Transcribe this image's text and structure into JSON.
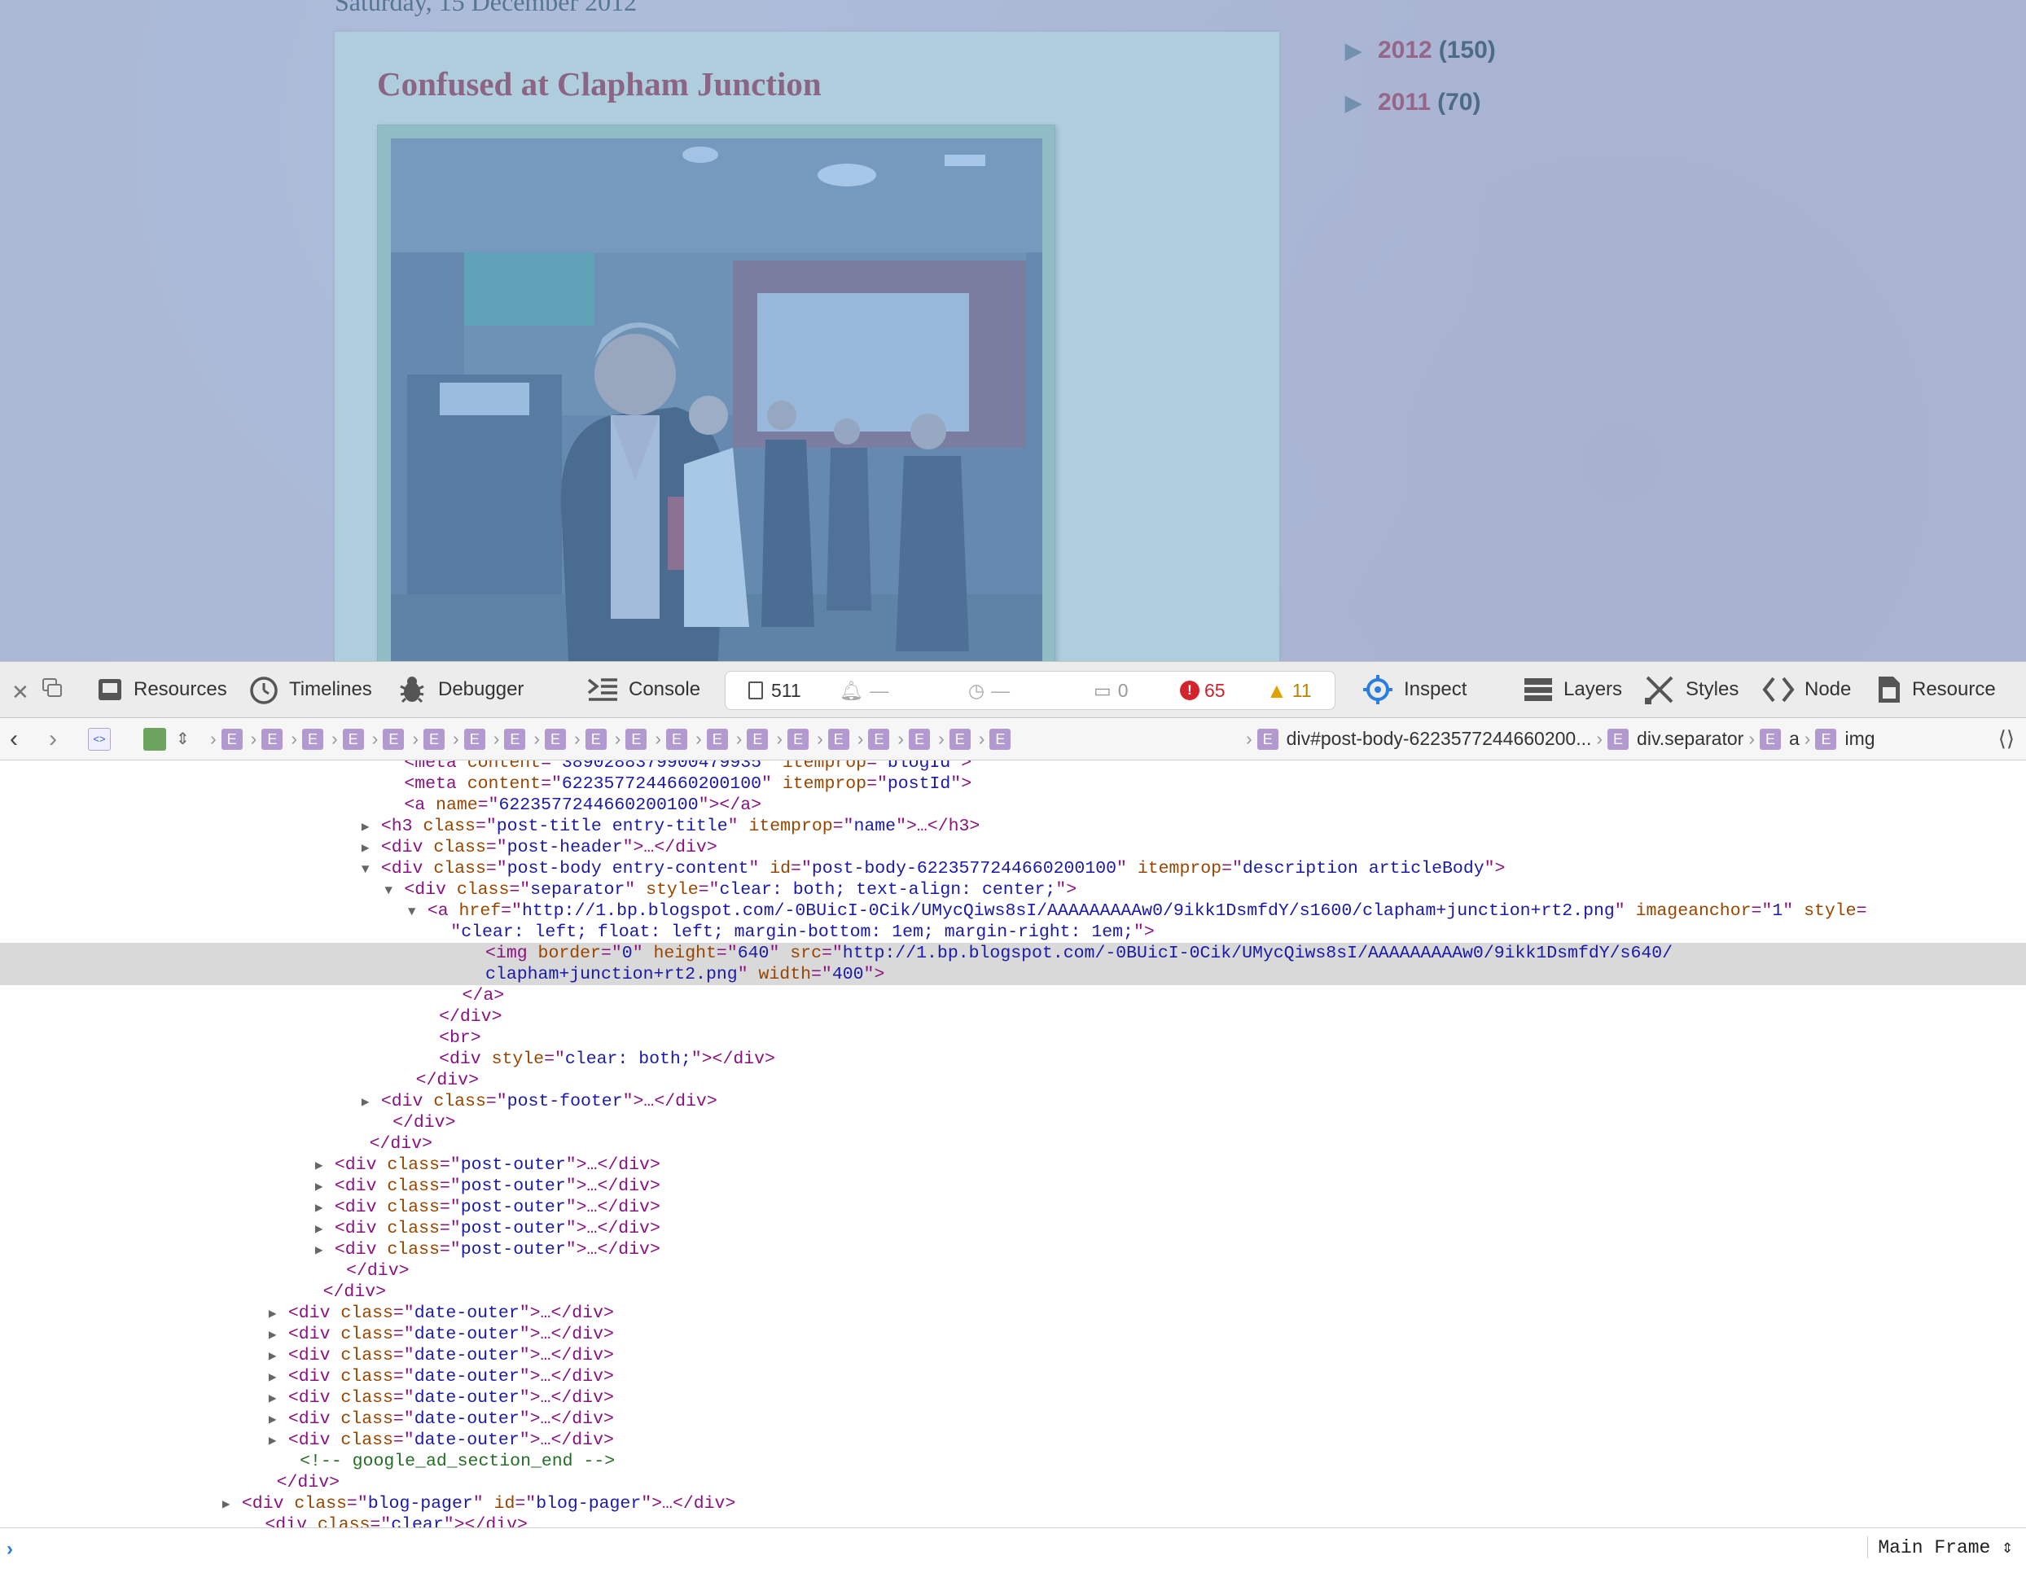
{
  "blog": {
    "date_header": "Saturday, 15 December 2012",
    "post_title": "Confused at Clapham Junction",
    "photo_alt": "clapham junction rt2",
    "archive": [
      {
        "year": "2012",
        "count": "(150)"
      },
      {
        "year": "2011",
        "count": "(70)"
      }
    ]
  },
  "toolbar": {
    "tabs": [
      {
        "label": "Resources",
        "icon": "resources-icon"
      },
      {
        "label": "Timelines",
        "icon": "timelines-icon"
      },
      {
        "label": "Debugger",
        "icon": "debugger-icon"
      },
      {
        "label": "Console",
        "icon": "console-icon"
      }
    ],
    "counters": {
      "resources": "511",
      "requests": "—",
      "time": "—",
      "logs": "0",
      "errors": "65",
      "warnings": "11"
    },
    "right_tabs": [
      {
        "label": "Inspect",
        "icon": "inspect-icon"
      },
      {
        "label": "Layers",
        "icon": "layers-icon"
      },
      {
        "label": "Styles",
        "icon": "styles-icon"
      },
      {
        "label": "Node",
        "icon": "node-icon"
      },
      {
        "label": "Resource",
        "icon": "resource-icon"
      }
    ]
  },
  "breadcrumbs": {
    "generic_label": "E",
    "post_body": "div#post-body-6223577244660200...",
    "separator": "div.separator",
    "anchor": "a",
    "img": "img"
  },
  "dom_lines": [
    {
      "indent": 34,
      "tw": "",
      "parts": [
        [
          "tg",
          "<meta "
        ],
        [
          "at",
          "content"
        ],
        [
          "tg",
          "=\""
        ],
        [
          "av",
          "3890288379900479935"
        ],
        [
          "tg",
          "\" "
        ],
        [
          "at",
          "itemprop"
        ],
        [
          "tg",
          "=\""
        ],
        [
          "av",
          "blogId"
        ],
        [
          "tg",
          "\">"
        ]
      ]
    },
    {
      "indent": 34,
      "tw": "",
      "parts": [
        [
          "tg",
          "<meta "
        ],
        [
          "at",
          "content"
        ],
        [
          "tg",
          "=\""
        ],
        [
          "av",
          "6223577244660200100"
        ],
        [
          "tg",
          "\" "
        ],
        [
          "at",
          "itemprop"
        ],
        [
          "tg",
          "=\""
        ],
        [
          "av",
          "postId"
        ],
        [
          "tg",
          "\">"
        ]
      ]
    },
    {
      "indent": 34,
      "tw": "",
      "parts": [
        [
          "tg",
          "<a "
        ],
        [
          "at",
          "name"
        ],
        [
          "tg",
          "=\""
        ],
        [
          "av",
          "6223577244660200100"
        ],
        [
          "tg",
          "\"></a>"
        ]
      ]
    },
    {
      "indent": 32,
      "tw": "▶",
      "parts": [
        [
          "tg",
          "<h3 "
        ],
        [
          "at",
          "class"
        ],
        [
          "tg",
          "=\""
        ],
        [
          "av",
          "post-title entry-title"
        ],
        [
          "tg",
          "\" "
        ],
        [
          "at",
          "itemprop"
        ],
        [
          "tg",
          "=\""
        ],
        [
          "av",
          "name"
        ],
        [
          "tg",
          "\">…</h3>"
        ]
      ]
    },
    {
      "indent": 32,
      "tw": "▶",
      "parts": [
        [
          "tg",
          "<div "
        ],
        [
          "at",
          "class"
        ],
        [
          "tg",
          "=\""
        ],
        [
          "av",
          "post-header"
        ],
        [
          "tg",
          "\">…</div>"
        ]
      ]
    },
    {
      "indent": 32,
      "tw": "▼",
      "parts": [
        [
          "tg",
          "<div "
        ],
        [
          "at",
          "class"
        ],
        [
          "tg",
          "=\""
        ],
        [
          "av",
          "post-body entry-content"
        ],
        [
          "tg",
          "\" "
        ],
        [
          "at",
          "id"
        ],
        [
          "tg",
          "=\""
        ],
        [
          "av",
          "post-body-6223577244660200100"
        ],
        [
          "tg",
          "\" "
        ],
        [
          "at",
          "itemprop"
        ],
        [
          "tg",
          "=\""
        ],
        [
          "av",
          "description articleBody"
        ],
        [
          "tg",
          "\">"
        ]
      ]
    },
    {
      "indent": 34,
      "tw": "▼",
      "parts": [
        [
          "tg",
          "<div "
        ],
        [
          "at",
          "class"
        ],
        [
          "tg",
          "=\""
        ],
        [
          "av",
          "separator"
        ],
        [
          "tg",
          "\" "
        ],
        [
          "at",
          "style"
        ],
        [
          "tg",
          "=\""
        ],
        [
          "av",
          "clear: both; text-align: center;"
        ],
        [
          "tg",
          "\">"
        ]
      ]
    },
    {
      "indent": 36,
      "tw": "▼",
      "parts": [
        [
          "tg",
          "<a "
        ],
        [
          "at",
          "href"
        ],
        [
          "tg",
          "=\""
        ],
        [
          "av",
          "http://1.bp.blogspot.com/-0BUicI-0Cik/UMycQiws8sI/AAAAAAAAAw0/9ikk1DsmfdY/s1600/clapham+junction+rt2.png"
        ],
        [
          "tg",
          "\" "
        ],
        [
          "at",
          "imageanchor"
        ],
        [
          "tg",
          "=\""
        ],
        [
          "av",
          "1"
        ],
        [
          "tg",
          "\" "
        ],
        [
          "at",
          "style"
        ],
        [
          "tg",
          "="
        ]
      ]
    },
    {
      "indent": 38,
      "tw": "",
      "parts": [
        [
          "tg",
          "\""
        ],
        [
          "av",
          "clear: left; float: left; margin-bottom: 1em; margin-right: 1em;"
        ],
        [
          "tg",
          "\">"
        ]
      ]
    },
    {
      "indent": 41,
      "tw": "",
      "sel": true,
      "parts": [
        [
          "tg",
          "<img "
        ],
        [
          "at",
          "border"
        ],
        [
          "tg",
          "=\""
        ],
        [
          "av",
          "0"
        ],
        [
          "tg",
          "\" "
        ],
        [
          "at",
          "height"
        ],
        [
          "tg",
          "=\""
        ],
        [
          "av",
          "640"
        ],
        [
          "tg",
          "\" "
        ],
        [
          "at",
          "src"
        ],
        [
          "tg",
          "=\""
        ],
        [
          "av",
          "http://1.bp.blogspot.com/-0BUicI-0Cik/UMycQiws8sI/AAAAAAAAAw0/9ikk1DsmfdY/s640/"
        ]
      ]
    },
    {
      "indent": 41,
      "tw": "",
      "sel": true,
      "parts": [
        [
          "av",
          "clapham+junction+rt2.png"
        ],
        [
          "tg",
          "\" "
        ],
        [
          "at",
          "width"
        ],
        [
          "tg",
          "=\""
        ],
        [
          "av",
          "400"
        ],
        [
          "tg",
          "\">"
        ]
      ]
    },
    {
      "indent": 39,
      "tw": "",
      "parts": [
        [
          "tg",
          "</a>"
        ]
      ]
    },
    {
      "indent": 37,
      "tw": "",
      "parts": [
        [
          "tg",
          "</div>"
        ]
      ]
    },
    {
      "indent": 37,
      "tw": "",
      "parts": [
        [
          "tg",
          "<br>"
        ]
      ]
    },
    {
      "indent": 37,
      "tw": "",
      "parts": [
        [
          "tg",
          "<div "
        ],
        [
          "at",
          "style"
        ],
        [
          "tg",
          "=\""
        ],
        [
          "av",
          "clear: both;"
        ],
        [
          "tg",
          "\"></div>"
        ]
      ]
    },
    {
      "indent": 35,
      "tw": "",
      "parts": [
        [
          "tg",
          "</div>"
        ]
      ]
    },
    {
      "indent": 32,
      "tw": "▶",
      "parts": [
        [
          "tg",
          "<div "
        ],
        [
          "at",
          "class"
        ],
        [
          "tg",
          "=\""
        ],
        [
          "av",
          "post-footer"
        ],
        [
          "tg",
          "\">…</div>"
        ]
      ]
    },
    {
      "indent": 33,
      "tw": "",
      "parts": [
        [
          "tg",
          "</div>"
        ]
      ]
    },
    {
      "indent": 31,
      "tw": "",
      "parts": [
        [
          "tg",
          "</div>"
        ]
      ]
    },
    {
      "indent": 28,
      "tw": "▶",
      "parts": [
        [
          "tg",
          "<div "
        ],
        [
          "at",
          "class"
        ],
        [
          "tg",
          "=\""
        ],
        [
          "av",
          "post-outer"
        ],
        [
          "tg",
          "\">…</div>"
        ]
      ]
    },
    {
      "indent": 28,
      "tw": "▶",
      "parts": [
        [
          "tg",
          "<div "
        ],
        [
          "at",
          "class"
        ],
        [
          "tg",
          "=\""
        ],
        [
          "av",
          "post-outer"
        ],
        [
          "tg",
          "\">…</div>"
        ]
      ]
    },
    {
      "indent": 28,
      "tw": "▶",
      "parts": [
        [
          "tg",
          "<div "
        ],
        [
          "at",
          "class"
        ],
        [
          "tg",
          "=\""
        ],
        [
          "av",
          "post-outer"
        ],
        [
          "tg",
          "\">…</div>"
        ]
      ]
    },
    {
      "indent": 28,
      "tw": "▶",
      "parts": [
        [
          "tg",
          "<div "
        ],
        [
          "at",
          "class"
        ],
        [
          "tg",
          "=\""
        ],
        [
          "av",
          "post-outer"
        ],
        [
          "tg",
          "\">…</div>"
        ]
      ]
    },
    {
      "indent": 28,
      "tw": "▶",
      "parts": [
        [
          "tg",
          "<div "
        ],
        [
          "at",
          "class"
        ],
        [
          "tg",
          "=\""
        ],
        [
          "av",
          "post-outer"
        ],
        [
          "tg",
          "\">…</div>"
        ]
      ]
    },
    {
      "indent": 29,
      "tw": "",
      "parts": [
        [
          "tg",
          "</div>"
        ]
      ]
    },
    {
      "indent": 27,
      "tw": "",
      "parts": [
        [
          "tg",
          "</div>"
        ]
      ]
    },
    {
      "indent": 24,
      "tw": "▶",
      "parts": [
        [
          "tg",
          "<div "
        ],
        [
          "at",
          "class"
        ],
        [
          "tg",
          "=\""
        ],
        [
          "av",
          "date-outer"
        ],
        [
          "tg",
          "\">…</div>"
        ]
      ]
    },
    {
      "indent": 24,
      "tw": "▶",
      "parts": [
        [
          "tg",
          "<div "
        ],
        [
          "at",
          "class"
        ],
        [
          "tg",
          "=\""
        ],
        [
          "av",
          "date-outer"
        ],
        [
          "tg",
          "\">…</div>"
        ]
      ]
    },
    {
      "indent": 24,
      "tw": "▶",
      "parts": [
        [
          "tg",
          "<div "
        ],
        [
          "at",
          "class"
        ],
        [
          "tg",
          "=\""
        ],
        [
          "av",
          "date-outer"
        ],
        [
          "tg",
          "\">…</div>"
        ]
      ]
    },
    {
      "indent": 24,
      "tw": "▶",
      "parts": [
        [
          "tg",
          "<div "
        ],
        [
          "at",
          "class"
        ],
        [
          "tg",
          "=\""
        ],
        [
          "av",
          "date-outer"
        ],
        [
          "tg",
          "\">…</div>"
        ]
      ]
    },
    {
      "indent": 24,
      "tw": "▶",
      "parts": [
        [
          "tg",
          "<div "
        ],
        [
          "at",
          "class"
        ],
        [
          "tg",
          "=\""
        ],
        [
          "av",
          "date-outer"
        ],
        [
          "tg",
          "\">…</div>"
        ]
      ]
    },
    {
      "indent": 24,
      "tw": "▶",
      "parts": [
        [
          "tg",
          "<div "
        ],
        [
          "at",
          "class"
        ],
        [
          "tg",
          "=\""
        ],
        [
          "av",
          "date-outer"
        ],
        [
          "tg",
          "\">…</div>"
        ]
      ]
    },
    {
      "indent": 24,
      "tw": "▶",
      "parts": [
        [
          "tg",
          "<div "
        ],
        [
          "at",
          "class"
        ],
        [
          "tg",
          "=\""
        ],
        [
          "av",
          "date-outer"
        ],
        [
          "tg",
          "\">…</div>"
        ]
      ]
    },
    {
      "indent": 25,
      "tw": "",
      "parts": [
        [
          "cm",
          "<!-- google_ad_section_end -->"
        ]
      ]
    },
    {
      "indent": 23,
      "tw": "",
      "parts": [
        [
          "tg",
          "</div>"
        ]
      ]
    },
    {
      "indent": 20,
      "tw": "▶",
      "parts": [
        [
          "tg",
          "<div "
        ],
        [
          "at",
          "class"
        ],
        [
          "tg",
          "=\""
        ],
        [
          "av",
          "blog-pager"
        ],
        [
          "tg",
          "\" "
        ],
        [
          "at",
          "id"
        ],
        [
          "tg",
          "=\""
        ],
        [
          "av",
          "blog-pager"
        ],
        [
          "tg",
          "\">…</div>"
        ]
      ]
    },
    {
      "indent": 22,
      "tw": "",
      "parts": [
        [
          "tg",
          "<div "
        ],
        [
          "at",
          "class"
        ],
        [
          "tg",
          "=\""
        ],
        [
          "av",
          "clear"
        ],
        [
          "tg",
          "\"></div>"
        ]
      ]
    }
  ],
  "console": {
    "prompt": "›",
    "frame": "Main Frame"
  }
}
